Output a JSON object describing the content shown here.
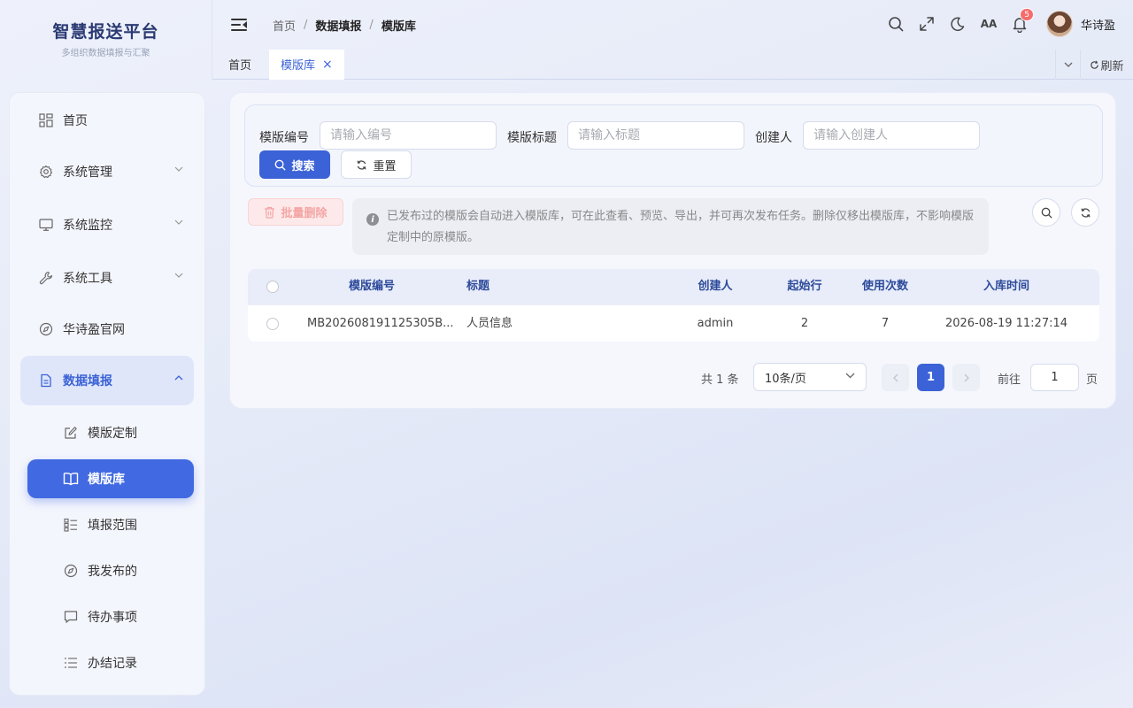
{
  "brand": {
    "title": "智慧报送平台",
    "subtitle": "多组织数据填报与汇聚"
  },
  "breadcrumb": [
    "首页",
    "数据填报",
    "模版库"
  ],
  "header": {
    "notification_count": "5",
    "user_name": "华诗盈",
    "font_size_label": "AA"
  },
  "tabs": [
    {
      "label": "首页",
      "active": false
    },
    {
      "label": "模版库",
      "active": true,
      "close": "×"
    }
  ],
  "tabs_tools": {
    "refresh_label": "刷新"
  },
  "sidebar": {
    "items": [
      {
        "label": "首页",
        "icon": "dashboard-icon"
      },
      {
        "label": "系统管理",
        "icon": "gear-icon"
      },
      {
        "label": "系统监控",
        "icon": "monitor-icon"
      },
      {
        "label": "系统工具",
        "icon": "wrench-icon"
      },
      {
        "label": "华诗盈官网",
        "icon": "compass-icon"
      },
      {
        "label": "数据填报",
        "icon": "document-icon",
        "open": true
      }
    ],
    "sub_items": [
      {
        "label": "模版定制",
        "icon": "edit-icon"
      },
      {
        "label": "模版库",
        "icon": "book-icon",
        "active": true
      },
      {
        "label": "填报范围",
        "icon": "list-grid-icon"
      },
      {
        "label": "我发布的",
        "icon": "compass-icon"
      },
      {
        "label": "待办事项",
        "icon": "message-icon"
      },
      {
        "label": "办结记录",
        "icon": "list-icon"
      }
    ]
  },
  "search": {
    "code_label": "模版编号",
    "code_placeholder": "请输入编号",
    "title_label": "模版标题",
    "title_placeholder": "请输入标题",
    "creator_label": "创建人",
    "creator_placeholder": "请输入创建人",
    "search_button": "搜索",
    "reset_button": "重置"
  },
  "toolbar": {
    "batch_delete": "批量删除",
    "notice": "已发布过的模版会自动进入模版库，可在此查看、预览、导出，并可再次发布任务。删除仅移出模版库，不影响模版定制中的原模版。"
  },
  "table": {
    "columns": [
      "模版编号",
      "标题",
      "创建人",
      "起始行",
      "使用次数",
      "入库时间"
    ],
    "rows": [
      {
        "code": "MB202608191125305B...",
        "title": "人员信息",
        "creator": "admin",
        "start_row": "2",
        "use_count": "7",
        "created_at": "2026-08-19 11:27:14"
      }
    ]
  },
  "pagination": {
    "total": "共 1 条",
    "page_size": "10条/页",
    "current_page": "1",
    "goto_label": "前往",
    "goto_value": "1",
    "page_suffix": "页"
  },
  "colors": {
    "primary": "#3b62d6",
    "danger_light": "#fde9e9",
    "header_text": "#2c4a9a"
  }
}
